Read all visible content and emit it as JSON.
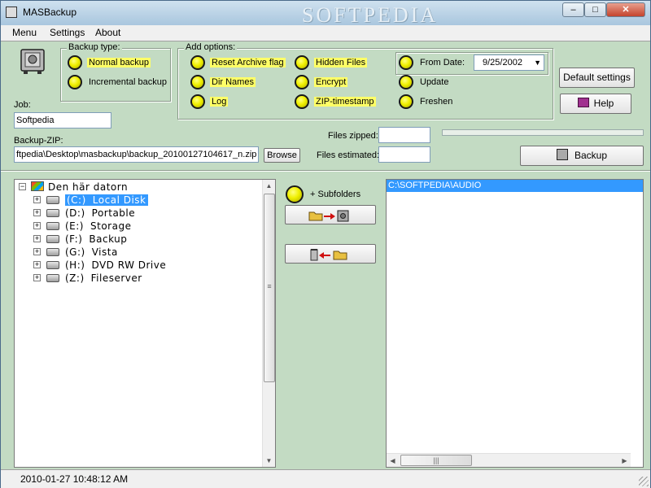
{
  "window": {
    "title": "MASBackup",
    "watermark": "SOFTPEDIA",
    "minimize_glyph": "–",
    "maximize_glyph": "□",
    "close_glyph": "✕"
  },
  "menu": {
    "items": [
      "Menu",
      "Settings",
      "About"
    ]
  },
  "backup_type": {
    "title": "Backup type:",
    "options": [
      "Normal backup",
      "Incremental backup"
    ]
  },
  "add_options": {
    "title": "Add options:",
    "col1": [
      "Reset Archive flag",
      "Dir Names",
      "Log"
    ],
    "col2": [
      "Hidden Files",
      "Encrypt",
      "ZIP-timestamp"
    ],
    "col3": [
      "Update",
      "Freshen"
    ],
    "from_date_label": "From Date:",
    "from_date_value": "9/25/2002"
  },
  "buttons": {
    "default_settings": "Default settings",
    "help": "Help",
    "browse": "Browse",
    "backup": "Backup",
    "subfolders": "+ Subfolders"
  },
  "job": {
    "label": "Job:",
    "value": "Softpedia"
  },
  "backup_zip": {
    "label": "Backup-ZIP:",
    "value": "ftpedia\\Desktop\\masbackup\\backup_20100127104617_n.zip"
  },
  "files": {
    "zipped_label": "Files zipped:",
    "zipped_value": "",
    "estimated_label": "Files estimated:",
    "estimated_value": ""
  },
  "tree": {
    "root": "Den här datorn",
    "drives": [
      {
        "letter": "(C:)",
        "name": "Local Disk"
      },
      {
        "letter": "(D:)",
        "name": "Portable"
      },
      {
        "letter": "(E:)",
        "name": "Storage"
      },
      {
        "letter": "(F:)",
        "name": "Backup"
      },
      {
        "letter": "(G:)",
        "name": "Vista"
      },
      {
        "letter": "(H:)",
        "name": "DVD RW Drive"
      },
      {
        "letter": "(Z:)",
        "name": "Fileserver"
      }
    ],
    "selected_index": 0
  },
  "selected_folders": {
    "items": [
      "C:\\SOFTPEDIA\\AUDIO"
    ]
  },
  "status": {
    "timestamp": "2010-01-27 10:48:12 AM"
  },
  "colors": {
    "background": "#c3dbc3",
    "highlight": "#ffff66",
    "selection": "#3399ff"
  }
}
